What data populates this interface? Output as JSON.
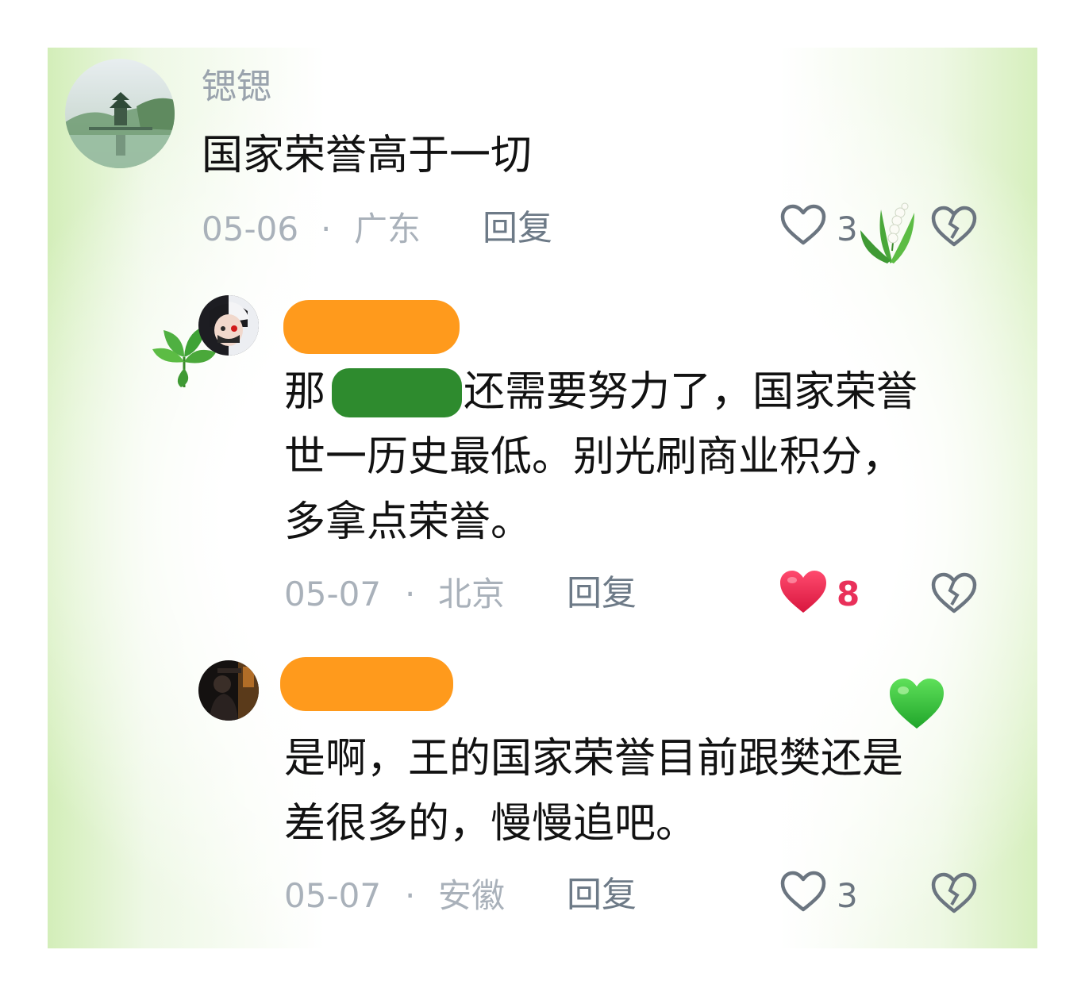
{
  "comments": [
    {
      "username": "锶锶",
      "text_lines": [
        "国家荣誉高于一切"
      ],
      "date": "05-06",
      "location": "广东",
      "reply_label": "回复",
      "likes": "3",
      "liked": false
    },
    {
      "username": "",
      "username_redacted": true,
      "text_lines": [
        "那",
        "还需要努力了，国家荣誉",
        "世一历史最低。别光刷商业积分，",
        "多拿点荣誉。"
      ],
      "date": "05-07",
      "location": "北京",
      "reply_label": "回复",
      "likes": "8",
      "liked": true
    },
    {
      "username": "",
      "username_redacted": true,
      "text_lines": [
        "是啊，王的国家荣誉目前跟樊还是",
        "差很多的，慢慢追吧。"
      ],
      "date": "05-07",
      "location": "安徽",
      "reply_label": "回复",
      "likes": "3",
      "liked": false
    }
  ],
  "separator": "·",
  "colors": {
    "redaction_orange": "#ff9a1c",
    "redaction_green": "#2e8b2e",
    "like_red": "#e9305a",
    "border_green": "#d3eeb9"
  },
  "icons": [
    "like-heart-icon",
    "dislike-broken-heart-icon",
    "lily-of-the-valley-sticker",
    "leaf-sticker",
    "green-heart-sticker"
  ]
}
